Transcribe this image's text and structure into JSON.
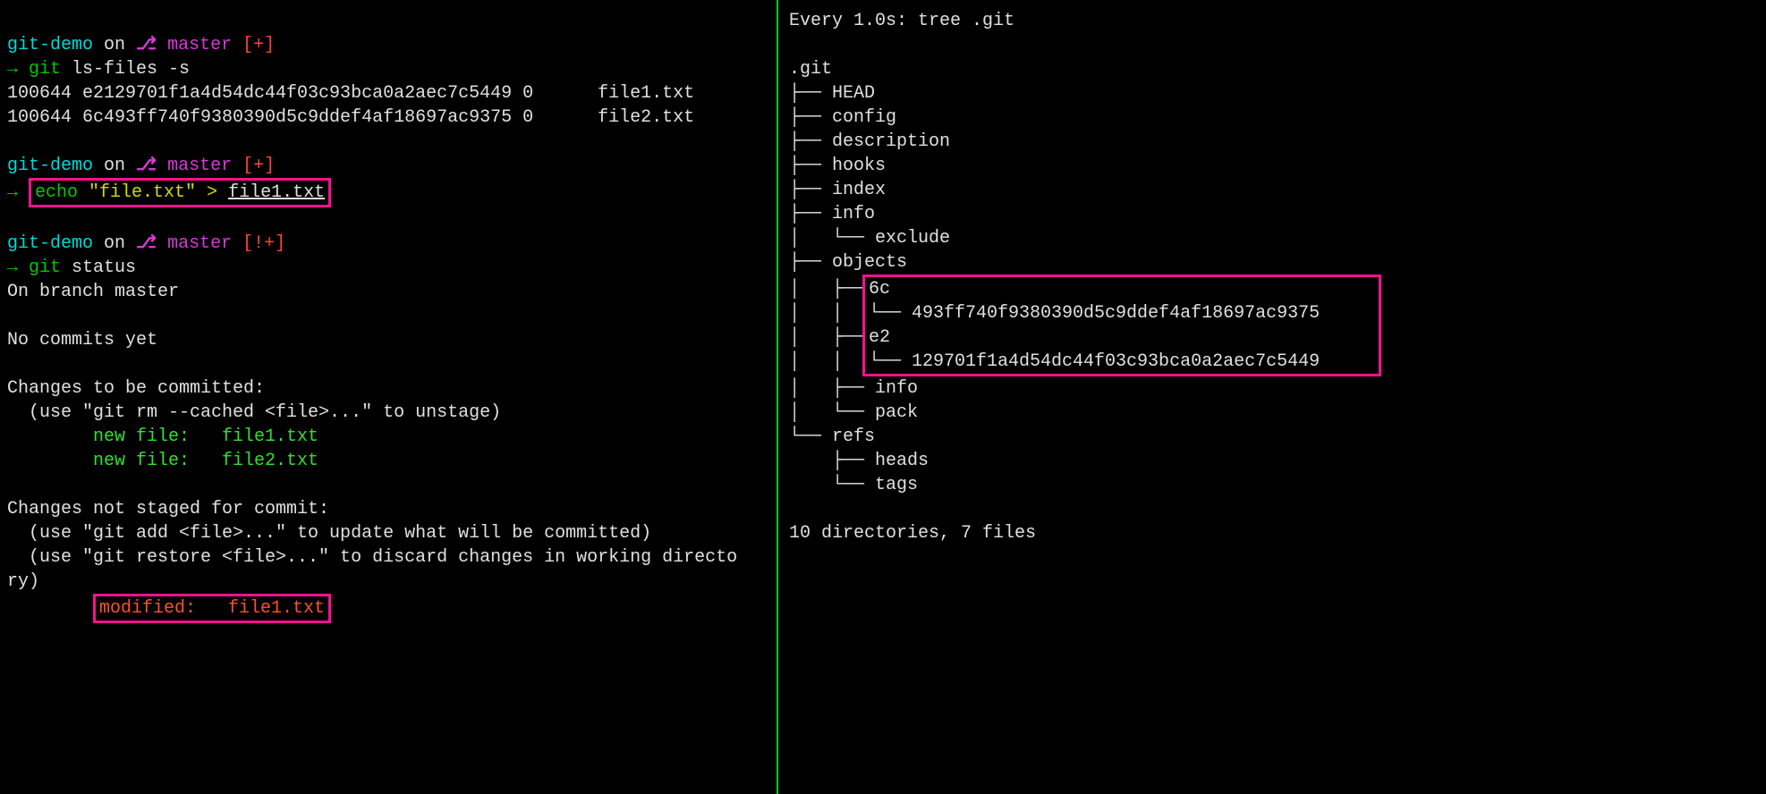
{
  "left": {
    "prompt1": {
      "dir": "git-demo",
      "on": " on ",
      "branch_glyph": "⎇",
      "branch": " master",
      "status": " [+]"
    },
    "cmd1": {
      "arrow": "→ ",
      "git": "git",
      "rest": " ls-files -s"
    },
    "lsfiles": {
      "line1a": "100644 e2129701f1a4d54dc44f03c93bca0a2aec7c5449 0",
      "line1b": "      file1.txt",
      "line2a": "100644 6c493ff740f9380390d5c9ddef4af18697ac9375 0",
      "line2b": "      file2.txt"
    },
    "prompt2": {
      "dir": "git-demo",
      "on": " on ",
      "branch_glyph": "⎇",
      "branch": " master",
      "status": " [+]"
    },
    "cmd2": {
      "arrow": "→ ",
      "echo": "echo",
      "mid": " \"file.txt\" > ",
      "file": "file1.txt"
    },
    "prompt3": {
      "dir": "git-demo",
      "on": " on ",
      "branch_glyph": "⎇",
      "branch": " master",
      "status": " [!+]"
    },
    "cmd3": {
      "arrow": "→ ",
      "git": "git",
      "rest": " status"
    },
    "status": {
      "on_branch": "On branch master",
      "no_commits": "No commits yet",
      "changes_committed": "Changes to be committed:",
      "unstage_hint": "  (use \"git rm --cached <file>...\" to unstage)",
      "new_file1": "        new file:   file1.txt",
      "new_file2": "        new file:   file2.txt",
      "changes_not_staged": "Changes not staged for commit:",
      "add_hint": "  (use \"git add <file>...\" to update what will be committed)",
      "restore_hint1": "  (use \"git restore <file>...\" to discard changes in working directo",
      "restore_hint2": "ry)",
      "modified": "modified:   file1.txt"
    }
  },
  "right": {
    "watch_header": "Every 1.0s: tree .git",
    "root": ".git",
    "l1_head": "├── HEAD",
    "l1_config": "├── config",
    "l1_description": "├── description",
    "l1_hooks": "├── hooks",
    "l1_index": "├── index",
    "l1_info": "├── info",
    "l2_exclude": "│   └── exclude",
    "l1_objects": "├── objects",
    "l2_6c": "│   ├── 6c",
    "l3_6c_hash": "│   │   └── 493ff740f9380390d5c9ddef4af18697ac9375",
    "l2_e2": "│   ├── e2",
    "l3_e2_hash": "│   │   └── 129701f1a4d54dc44f03c93bca0a2aec7c5449",
    "l2_obj_info": "│   ├── info",
    "l2_pack": "│   └── pack",
    "l1_refs": "└── refs",
    "l2_heads": "    ├── heads",
    "l2_tags": "    └── tags",
    "summary": "10 directories, 7 files"
  }
}
